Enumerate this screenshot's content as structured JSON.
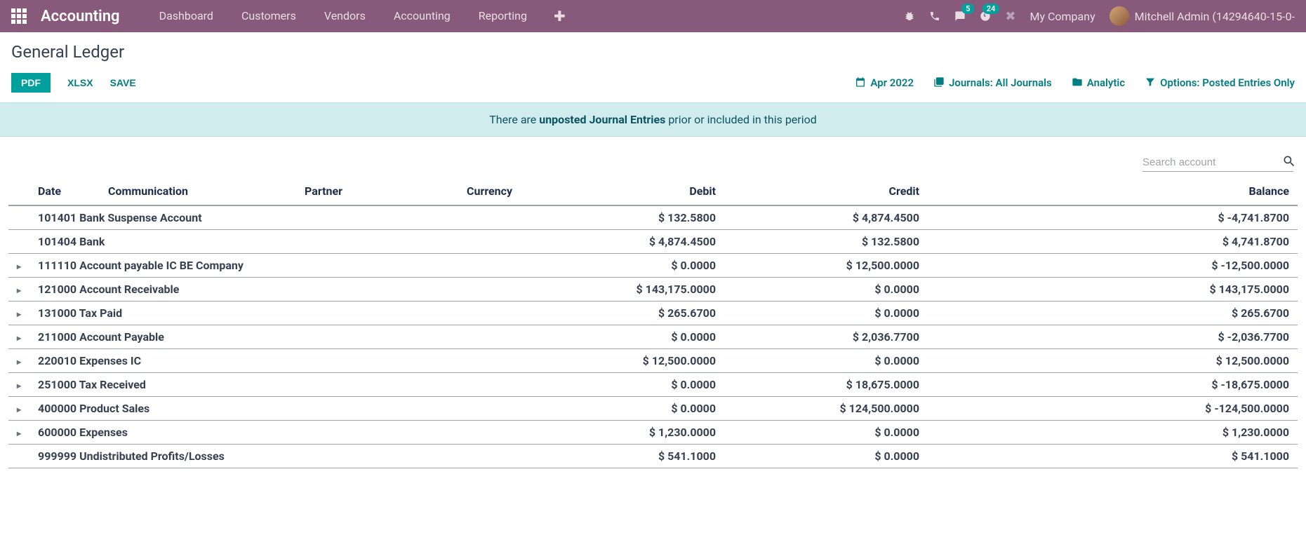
{
  "topbar": {
    "brand": "Accounting",
    "nav": [
      "Dashboard",
      "Customers",
      "Vendors",
      "Accounting",
      "Reporting"
    ],
    "messaging_badge": "5",
    "activities_badge": "24",
    "company": "My Company",
    "user": "Mitchell Admin (14294640-15-0-"
  },
  "page": {
    "title": "General Ledger"
  },
  "toolbar": {
    "pdf": "PDF",
    "xlsx": "XLSX",
    "save": "SAVE"
  },
  "filters": {
    "date": "Apr 2022",
    "journals": "Journals: All Journals",
    "analytic": "Analytic",
    "options": "Options: Posted Entries Only"
  },
  "banner": {
    "pre": "There are ",
    "strong": "unposted Journal Entries",
    "post": " prior or included in this period"
  },
  "search": {
    "placeholder": "Search account"
  },
  "columns": {
    "date": "Date",
    "communication": "Communication",
    "partner": "Partner",
    "currency": "Currency",
    "debit": "Debit",
    "credit": "Credit",
    "balance": "Balance"
  },
  "rows": [
    {
      "expandable": false,
      "name": "101401 Bank Suspense Account",
      "debit": "$ 132.5800",
      "credit": "$ 4,874.4500",
      "balance": "$ -4,741.8700"
    },
    {
      "expandable": false,
      "name": "101404 Bank",
      "debit": "$ 4,874.4500",
      "credit": "$ 132.5800",
      "balance": "$ 4,741.8700"
    },
    {
      "expandable": true,
      "name": "111110 Account payable IC BE Company",
      "debit": "$ 0.0000",
      "credit": "$ 12,500.0000",
      "balance": "$ -12,500.0000"
    },
    {
      "expandable": true,
      "name": "121000 Account Receivable",
      "debit": "$ 143,175.0000",
      "credit": "$ 0.0000",
      "balance": "$ 143,175.0000"
    },
    {
      "expandable": true,
      "name": "131000 Tax Paid",
      "debit": "$ 265.6700",
      "credit": "$ 0.0000",
      "balance": "$ 265.6700"
    },
    {
      "expandable": true,
      "name": "211000 Account Payable",
      "debit": "$ 0.0000",
      "credit": "$ 2,036.7700",
      "balance": "$ -2,036.7700"
    },
    {
      "expandable": true,
      "name": "220010 Expenses IC",
      "debit": "$ 12,500.0000",
      "credit": "$ 0.0000",
      "balance": "$ 12,500.0000"
    },
    {
      "expandable": true,
      "name": "251000 Tax Received",
      "debit": "$ 0.0000",
      "credit": "$ 18,675.0000",
      "balance": "$ -18,675.0000"
    },
    {
      "expandable": true,
      "name": "400000 Product Sales",
      "debit": "$ 0.0000",
      "credit": "$ 124,500.0000",
      "balance": "$ -124,500.0000"
    },
    {
      "expandable": true,
      "name": "600000 Expenses",
      "debit": "$ 1,230.0000",
      "credit": "$ 0.0000",
      "balance": "$ 1,230.0000"
    },
    {
      "expandable": false,
      "name": "999999 Undistributed Profits/Losses",
      "debit": "$ 541.1000",
      "credit": "$ 0.0000",
      "balance": "$ 541.1000"
    }
  ]
}
